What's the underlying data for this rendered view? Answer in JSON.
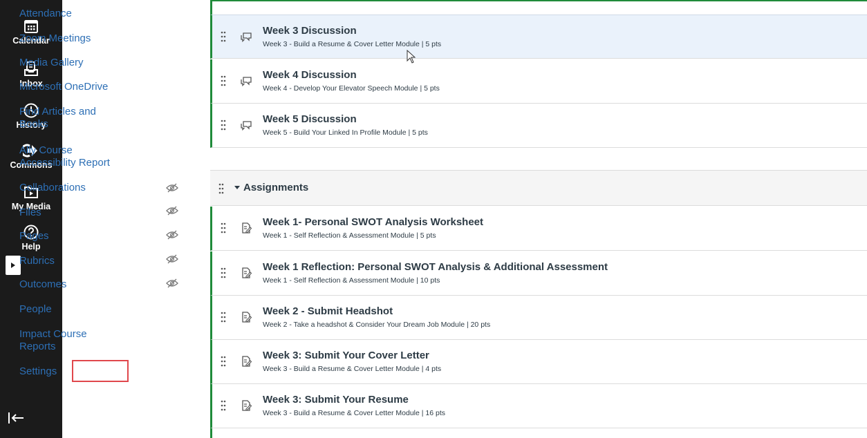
{
  "global_nav": {
    "items": [
      {
        "label": "Calendar",
        "icon": "calendar-icon"
      },
      {
        "label": "Inbox",
        "icon": "inbox-icon"
      },
      {
        "label": "History",
        "icon": "clock-icon"
      },
      {
        "label": "Commons",
        "icon": "commons-icon"
      },
      {
        "label": "My Media",
        "icon": "media-folder-icon"
      },
      {
        "label": "Help",
        "icon": "help-icon"
      }
    ]
  },
  "course_nav": {
    "items": [
      {
        "label": "Attendance",
        "hidden": false
      },
      {
        "label": "Zoom Meetings",
        "hidden": false
      },
      {
        "label": "Media Gallery",
        "hidden": false
      },
      {
        "label": "Microsoft OneDrive",
        "hidden": false
      },
      {
        "label": "Find Articles and Books",
        "hidden": false
      },
      {
        "label": "Ally Course Accessibility Report",
        "hidden": false
      },
      {
        "label": "Collaborations",
        "hidden": true
      },
      {
        "label": "Files",
        "hidden": true
      },
      {
        "label": "Pages",
        "hidden": true
      },
      {
        "label": "Rubrics",
        "hidden": true
      },
      {
        "label": "Outcomes",
        "hidden": true
      },
      {
        "label": "People",
        "hidden": false
      },
      {
        "label": "Impact Course Reports",
        "hidden": false
      },
      {
        "label": "Settings",
        "hidden": false
      }
    ]
  },
  "discussions": [
    {
      "title": "Week 3 Discussion",
      "meta": "Week 3 - Build a Resume & Cover Letter Module  |  5 pts"
    },
    {
      "title": "Week 4 Discussion",
      "meta": "Week 4 - Develop Your Elevator Speech Module  |  5 pts"
    },
    {
      "title": "Week 5 Discussion",
      "meta": "Week 5 - Build Your Linked In Profile Module  |  5 pts"
    }
  ],
  "assignments_group": {
    "title": "Assignments",
    "items": [
      {
        "title": "Week 1- Personal SWOT Analysis Worksheet",
        "meta": "Week 1 - Self Reflection & Assessment Module  |  5 pts"
      },
      {
        "title": "Week 1 Reflection: Personal SWOT Analysis & Additional Assessment",
        "meta": "Week 1 - Self Reflection & Assessment Module  |  10 pts"
      },
      {
        "title": "Week 2 - Submit Headshot",
        "meta": "Week 2 - Take a headshot & Consider Your Dream Job Module  |  20 pts"
      },
      {
        "title": "Week 3: Submit Your Cover Letter",
        "meta": "Week 3 - Build a Resume & Cover Letter Module  |  4 pts"
      },
      {
        "title": "Week 3: Submit Your Resume",
        "meta": "Week 3 - Build a Resume & Cover Letter Module  |  16 pts"
      }
    ]
  },
  "colors": {
    "global_nav_bg": "#1b1b1b",
    "link": "#2d6fb5",
    "published_bar": "#1f8b3a",
    "highlight_box": "#e0474c"
  }
}
